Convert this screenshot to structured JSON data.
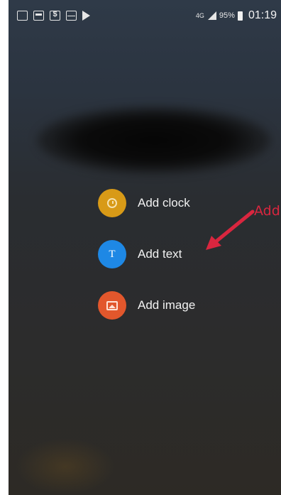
{
  "status_bar": {
    "network": "4G",
    "battery_percent": "95%",
    "time": "01:19",
    "left_icons": [
      "gallery-icon",
      "image-icon",
      "money-icon",
      "mail-icon",
      "play-store-icon"
    ]
  },
  "menu": {
    "items": [
      {
        "label": "Add clock",
        "icon": "clock-icon",
        "color": "#d89a17"
      },
      {
        "label": "Add text",
        "icon": "text-icon",
        "color": "#1e88e5"
      },
      {
        "label": "Add image",
        "icon": "image-icon",
        "color": "#e2572c"
      }
    ]
  },
  "annotation": {
    "text": "Add",
    "color": "#d9263f"
  }
}
